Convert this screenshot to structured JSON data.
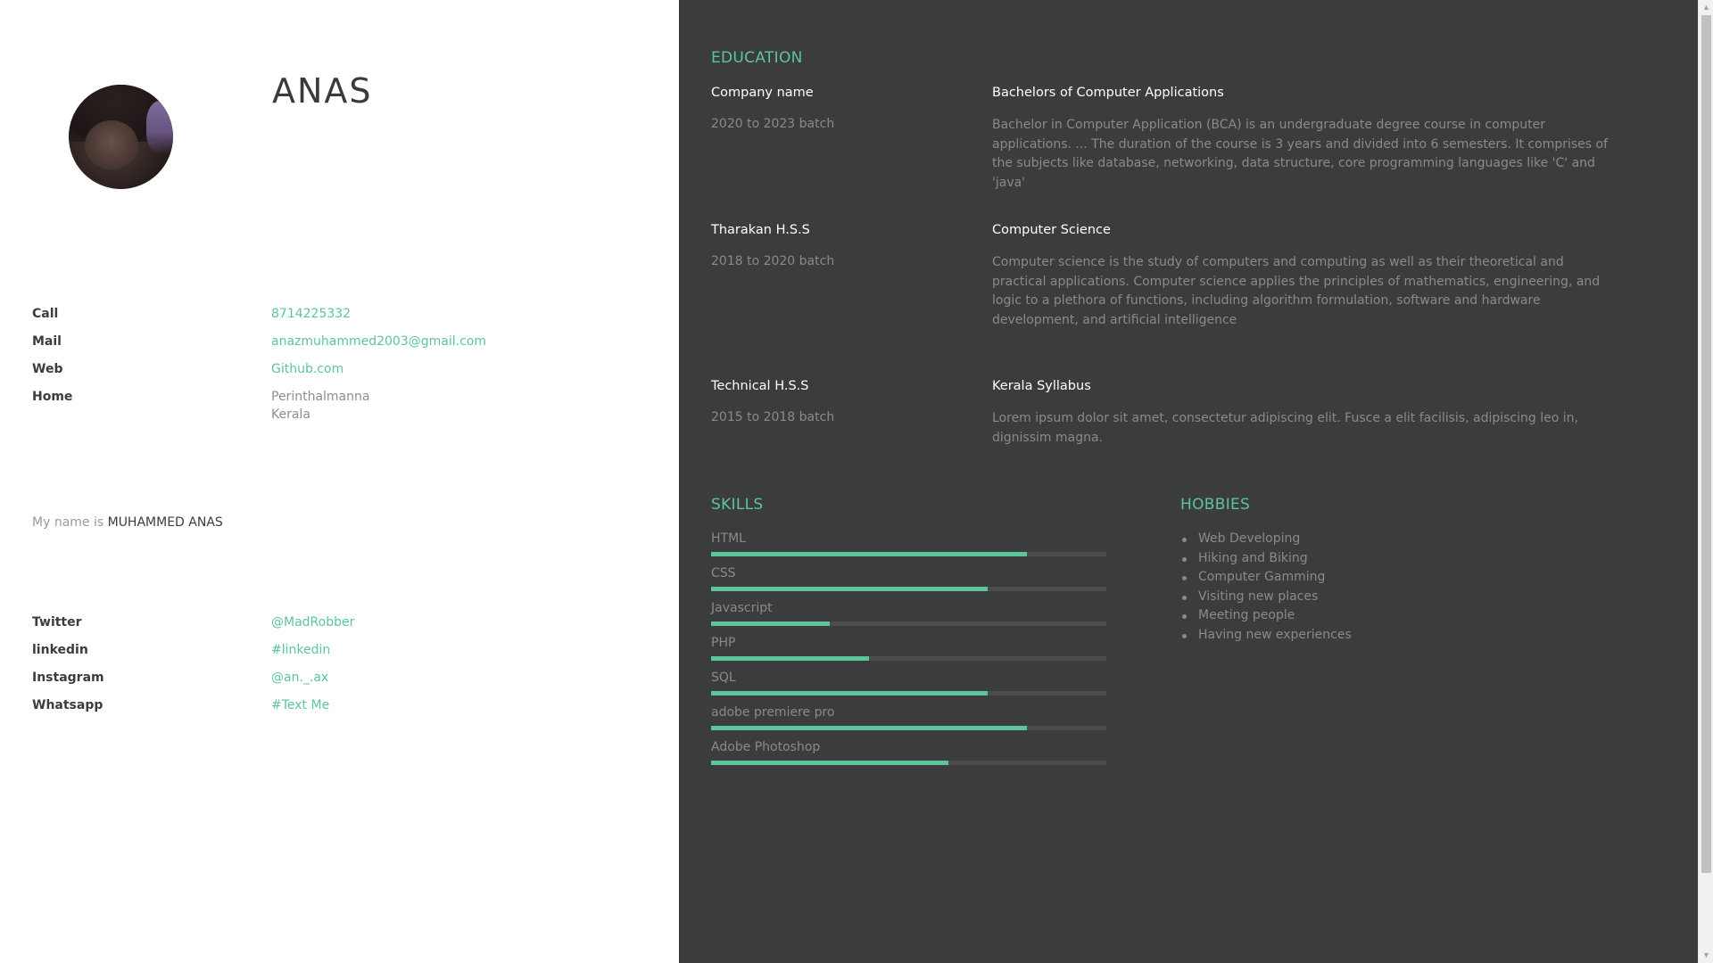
{
  "profile": {
    "name": "ANAS",
    "bio_prefix": "My name is",
    "bio_name": "MUHAMMED ANAS"
  },
  "contact": [
    {
      "label": "Call",
      "value": "8714225332"
    },
    {
      "label": "Mail",
      "value": "anazmuhammed2003@gmail.com"
    },
    {
      "label": "Web",
      "value": "Github.com"
    },
    {
      "label": "Home",
      "value": "Perinthalmanna",
      "value2": "Kerala"
    }
  ],
  "social": [
    {
      "label": "Twitter",
      "value": "@MadRobber"
    },
    {
      "label": "linkedin",
      "value": "#linkedin"
    },
    {
      "label": "Instagram",
      "value": "@an._.ax"
    },
    {
      "label": "Whatsapp",
      "value": "#Text Me"
    }
  ],
  "education": {
    "title": "EDUCATION",
    "items": [
      {
        "school": "Company name",
        "batch": "2020 to 2023 batch",
        "degree": "Bachelors of Computer Applications",
        "description": "Bachelor in Computer Application (BCA) is an undergraduate degree course in computer applications. ... The duration of the course is 3 years and divided into 6 semesters. It comprises of the subjects like database, networking, data structure, core programming languages like 'C' and 'java'"
      },
      {
        "school": "Tharakan H.S.S",
        "batch": "2018 to 2020 batch",
        "degree": "Computer Science",
        "description": "Computer science is the study of computers and computing as well as their theoretical and practical applications. Computer science applies the principles of mathematics, engineering, and logic to a plethora of functions, including algorithm formulation, software and hardware development, and artificial intelligence"
      },
      {
        "school": "Technical H.S.S",
        "batch": "2015 to 2018 batch",
        "degree": "Kerala Syllabus",
        "description": "Lorem ipsum dolor sit amet, consectetur adipiscing elit. Fusce a elit facilisis, adipiscing leo in, dignissim magna."
      }
    ]
  },
  "skills": {
    "title": "SKILLS",
    "items": [
      {
        "name": "HTML",
        "level": 80
      },
      {
        "name": "CSS",
        "level": 70
      },
      {
        "name": "Javascript",
        "level": 30
      },
      {
        "name": "PHP",
        "level": 40
      },
      {
        "name": "SQL",
        "level": 70
      },
      {
        "name": "adobe premiere pro",
        "level": 80
      },
      {
        "name": "Adobe Photoshop",
        "level": 60
      }
    ]
  },
  "hobbies": {
    "title": "HOBBIES",
    "items": [
      "Web Developing",
      "Hiking and Biking",
      "Computer Gamming",
      "Visiting new places",
      "Meeting people",
      "Having new experiences"
    ]
  },
  "colors": {
    "accent": "#5dc59a",
    "dark_panel": "#3b3c3e",
    "light_panel": "#ffffff"
  },
  "icons": {
    "scroll_up": "▲",
    "scroll_down": "▼"
  }
}
